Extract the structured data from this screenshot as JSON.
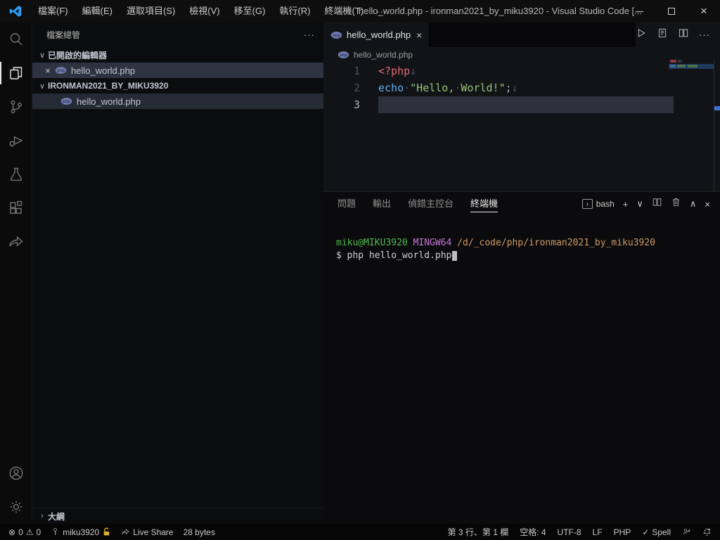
{
  "glyphs": {
    "close": "×",
    "plus": "+",
    "chevron_down": "∨",
    "chevron_up": "∧",
    "chevron_right": "›",
    "more": "···",
    "error": "⊗",
    "warning": "⚠",
    "check": "✓"
  },
  "titlebar": {
    "menus": [
      "檔案(F)",
      "編輯(E)",
      "選取項目(S)",
      "檢視(V)",
      "移至(G)",
      "執行(R)",
      "終端機(T)"
    ],
    "title": "hello_world.php - ironman2021_by_miku3920 - Visual Studio Code [..."
  },
  "sidebar": {
    "header": "檔案總管",
    "open_editors": {
      "label": "已開啟的編輯器",
      "items": [
        {
          "name": "hello_world.php"
        }
      ]
    },
    "folder": {
      "label": "IRONMAN2021_BY_MIKU3920",
      "items": [
        {
          "name": "hello_world.php"
        }
      ]
    },
    "outline_label": "大綱"
  },
  "editor": {
    "tab": {
      "label": "hello_world.php"
    },
    "breadcrumb": "hello_world.php",
    "line_numbers": [
      "1",
      "2",
      "3"
    ],
    "code": {
      "l1_php_tag": "<?php",
      "l1_ws": "↓",
      "l2_echo": "echo",
      "l2_dot1": "·",
      "l2_str1": "\"Hello,",
      "l2_dot2": "·",
      "l2_str2": "World!\"",
      "l2_semi": ";",
      "l2_ws": "↓"
    }
  },
  "panel": {
    "tabs": [
      "問題",
      "輸出",
      "偵錯主控台",
      "終端機"
    ],
    "shell": "bash",
    "terminal": {
      "prompt_user": "miku@MIKU3920",
      "prompt_env": "MINGW64",
      "prompt_path": "/d/_code/php/ironman2021_by_miku3920",
      "command": "$ php hello_world.php"
    }
  },
  "statusbar": {
    "errors": "0",
    "warnings": "0",
    "account": "miku3920",
    "live_share": "Live Share",
    "file_size": "28 bytes",
    "cursor": "第 3 行、第 1 欄",
    "indent": "空格: 4",
    "encoding": "UTF-8",
    "eol": "LF",
    "language": "PHP",
    "spell": "Spell"
  },
  "colors": {
    "accent_blue": "#3e6fd0",
    "php_icon": "#6d79ad",
    "lock": "#e2ae33",
    "terminal_green": "#50b950",
    "terminal_purple": "#c678dd",
    "terminal_orange": "#d19a66",
    "code_red": "#e06c75",
    "code_blue": "#61afef",
    "code_green": "#98c379"
  }
}
